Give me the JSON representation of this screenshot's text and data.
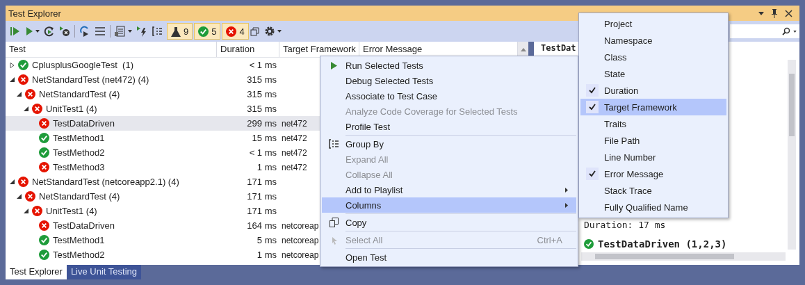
{
  "window": {
    "title": "Test Explorer"
  },
  "toolbar": {
    "badges": [
      {
        "count": "9"
      },
      {
        "count": "5"
      },
      {
        "count": "4"
      }
    ]
  },
  "tests": {
    "columns": [
      "Test",
      "Duration",
      "Target Framework",
      "Error Message"
    ],
    "rows": [
      {
        "name": "CplusplusGoogleTest  (1)",
        "duration": "< 1 ms",
        "kind": "passed",
        "expanded": false,
        "selected": false
      },
      {
        "name": "NetStandardTest (net472)",
        "count": "(4)",
        "duration": "315 ms",
        "kind": "failed",
        "expanded": true,
        "selected": false,
        "children": [
          {
            "name": "NetStandardTest",
            "count": "(4)",
            "duration": "315 ms",
            "kind": "failed",
            "expanded": true,
            "selected": false,
            "children": [
              {
                "name": "UnitTest1",
                "count": "(4)",
                "duration": "315 ms",
                "kind": "failed",
                "expanded": true,
                "selected": false,
                "children": [
                  {
                    "name": "TestDataDriven",
                    "duration": "299 ms",
                    "framework": "net472",
                    "kind": "failed",
                    "selected": true
                  },
                  {
                    "name": "TestMethod1",
                    "duration": "15 ms",
                    "framework": "net472",
                    "kind": "passed",
                    "selected": false
                  },
                  {
                    "name": "TestMethod2",
                    "duration": "< 1 ms",
                    "framework": "net472",
                    "kind": "passed",
                    "selected": false
                  },
                  {
                    "name": "TestMethod3",
                    "duration": "1 ms",
                    "framework": "net472",
                    "kind": "failed",
                    "selected": false
                  }
                ]
              }
            ]
          }
        ]
      },
      {
        "name": "NetStandardTest (netcoreapp2.1)",
        "count": "(4)",
        "duration": "171 ms",
        "kind": "failed",
        "expanded": true,
        "selected": false,
        "children": [
          {
            "name": "NetStandardTest",
            "count": "(4)",
            "duration": "171 ms",
            "kind": "failed",
            "expanded": true,
            "selected": false,
            "children": [
              {
                "name": "UnitTest1",
                "count": "(4)",
                "duration": "171 ms",
                "kind": "failed",
                "expanded": true,
                "selected": false,
                "children": [
                  {
                    "name": "TestDataDriven",
                    "duration": "164 ms",
                    "framework": "netcoreap",
                    "kind": "failed",
                    "selected": false
                  },
                  {
                    "name": "TestMethod1",
                    "duration": "5 ms",
                    "framework": "netcoreap",
                    "kind": "passed",
                    "selected": false
                  },
                  {
                    "name": "TestMethod2",
                    "duration": "1 ms",
                    "framework": "netcoreap",
                    "kind": "passed",
                    "selected": false
                  }
                ]
              }
            ]
          }
        ]
      }
    ]
  },
  "details": {
    "heading": "TestDat",
    "duration": "Duration: 17 ms",
    "result": {
      "name": "TestDataDriven (1,2,3)",
      "kind": "passed"
    }
  },
  "context_menu": {
    "groups": [
      [
        {
          "label": "Run Selected Tests",
          "disabled": false,
          "selected": false
        },
        {
          "label": "Debug Selected Tests",
          "disabled": false,
          "selected": false
        },
        {
          "label": "Associate to Test Case",
          "disabled": false,
          "selected": false
        },
        {
          "label": "Analyze Code Coverage for Selected Tests",
          "disabled": true,
          "selected": false
        },
        {
          "label": "Profile Test",
          "disabled": false,
          "selected": false
        }
      ],
      [
        {
          "label": "Group By",
          "disabled": false,
          "selected": false
        },
        {
          "label": "Expand All",
          "disabled": true,
          "selected": false
        },
        {
          "label": "Collapse All",
          "disabled": true,
          "selected": false
        },
        {
          "label": "Add to Playlist",
          "disabled": false,
          "selected": false,
          "submenu": true
        },
        {
          "label": "Columns",
          "disabled": false,
          "selected": true,
          "submenu": true
        }
      ],
      [
        {
          "label": "Copy",
          "disabled": false,
          "selected": false
        }
      ],
      [
        {
          "label": "Select All",
          "disabled": true,
          "selected": false,
          "shortcut": "Ctrl+A"
        }
      ],
      [
        {
          "label": "Open Test",
          "disabled": false,
          "selected": false
        }
      ]
    ]
  },
  "columns_menu": {
    "items": [
      {
        "label": "Project",
        "checked": false,
        "selected": false
      },
      {
        "label": "Namespace",
        "checked": false,
        "selected": false
      },
      {
        "label": "Class",
        "checked": false,
        "selected": false
      },
      {
        "label": "State",
        "checked": false,
        "selected": false
      },
      {
        "label": "Duration",
        "checked": true,
        "selected": false
      },
      {
        "label": "Target Framework",
        "checked": true,
        "selected": true
      },
      {
        "label": "Traits",
        "checked": false,
        "selected": false
      },
      {
        "label": "File Path",
        "checked": false,
        "selected": false
      },
      {
        "label": "Line Number",
        "checked": false,
        "selected": false
      },
      {
        "label": "Error Message",
        "checked": true,
        "selected": false
      },
      {
        "label": "Stack Trace",
        "checked": false,
        "selected": false
      },
      {
        "label": "Fully Qualified Name",
        "checked": false,
        "selected": false
      }
    ]
  },
  "bottom_tabs": [
    {
      "label": "Test Explorer",
      "selected": true
    },
    {
      "label": "Live Unit Testing",
      "selected": false
    }
  ]
}
